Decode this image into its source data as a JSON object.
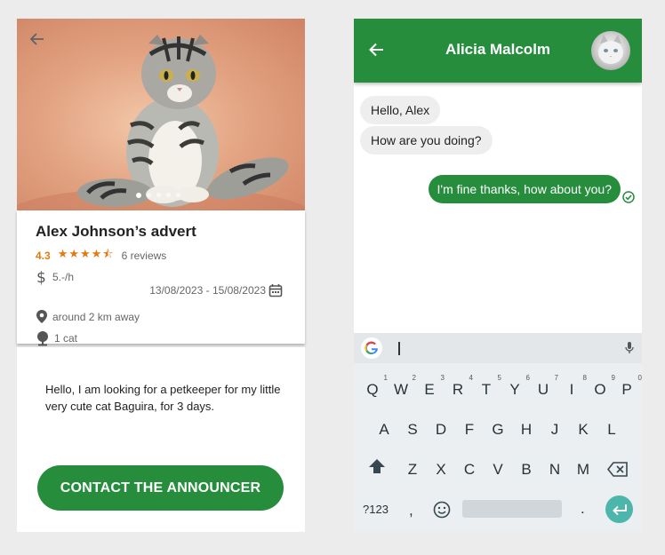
{
  "advert": {
    "back_icon": "arrow-left-icon",
    "title": "Alex Johnson’s advert",
    "rating": "4.3",
    "stars": "★★★★⯪",
    "reviews": "6 reviews",
    "price": "5.-/h",
    "dates": "13/08/2023 - 15/08/2023",
    "distance": "around 2 km away",
    "pets": "1 cat",
    "description": "Hello, I am looking for a petkeeper for my little very cute cat Baguira, for 3 days.",
    "contact_label": "CONTACT THE ANNOUNCER",
    "slides_total": 5,
    "slide_active": 1
  },
  "chat": {
    "contact_name": "Alicia Malcolm",
    "messages": [
      {
        "from": "them",
        "text": "Hello, Alex"
      },
      {
        "from": "them",
        "text": "How are you doing?"
      },
      {
        "from": "me",
        "text": "I'm fine thanks, how about you?"
      }
    ],
    "input_value": ""
  },
  "keyboard": {
    "row1": [
      "Q",
      "W",
      "E",
      "R",
      "T",
      "Y",
      "U",
      "I",
      "O",
      "P"
    ],
    "row1_hints": [
      "1",
      "2",
      "3",
      "4",
      "5",
      "6",
      "7",
      "8",
      "9",
      "0"
    ],
    "row2": [
      "A",
      "S",
      "D",
      "F",
      "G",
      "H",
      "J",
      "K",
      "L"
    ],
    "row3": [
      "Z",
      "X",
      "C",
      "V",
      "B",
      "N",
      "M"
    ],
    "symbols_label": "?123",
    "comma": ",",
    "period": "."
  },
  "colors": {
    "primary_green": "#268d3d",
    "rating_orange": "#e07b14",
    "enter_teal": "#4db6ac"
  }
}
